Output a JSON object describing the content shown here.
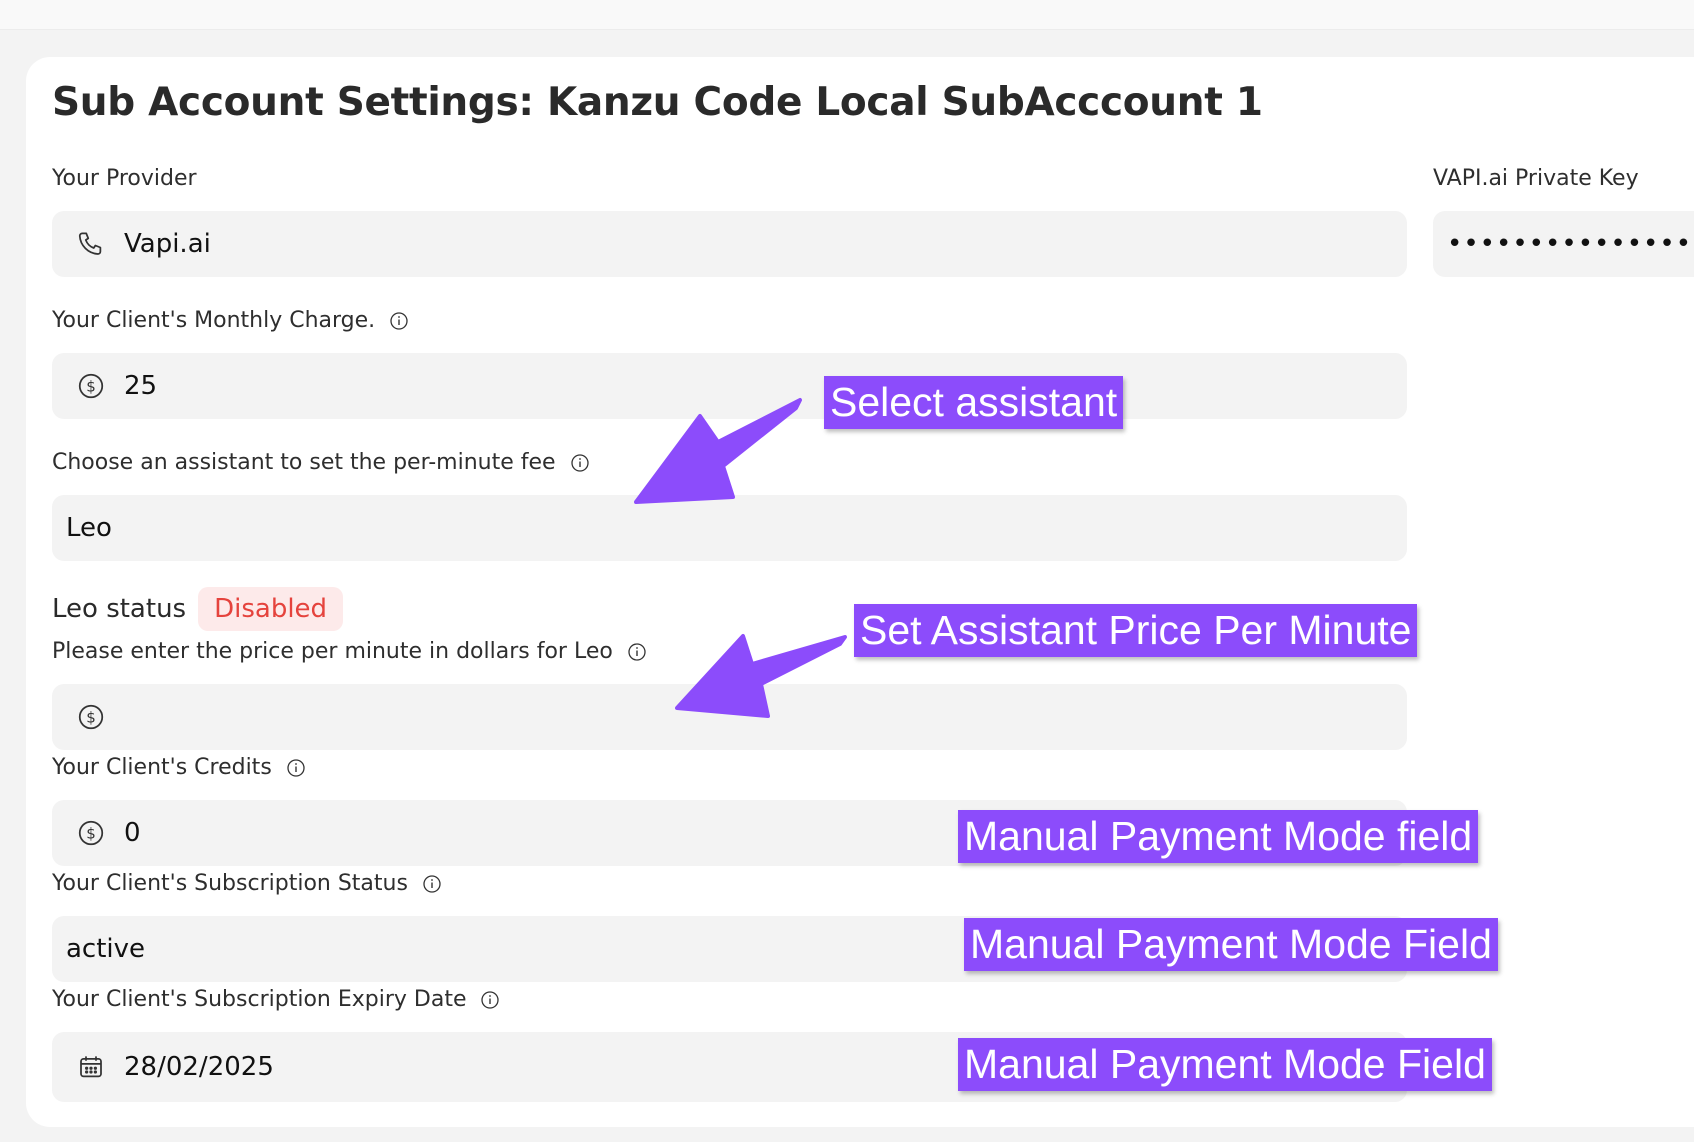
{
  "header": {
    "title": "Sub Account Settings: Kanzu Code Local SubAcccount 1"
  },
  "provider": {
    "label": "Your Provider",
    "value": "Vapi.ai",
    "icon": "phone-icon"
  },
  "vapi_key": {
    "label": "VAPI.ai Private Key",
    "value": "•••••••••••••••••••••••••••"
  },
  "monthly_charge": {
    "label": "Your Client's Monthly Charge.",
    "value": "25",
    "icon": "dollar-icon"
  },
  "assistant": {
    "label": "Choose an assistant to set the per-minute fee",
    "value": "Leo"
  },
  "assistant_status": {
    "label": "Leo status",
    "badge": "Disabled",
    "badge_color": "#e5433d"
  },
  "price_per_minute": {
    "label": "Please enter the price per minute in dollars for Leo",
    "value": "",
    "icon": "dollar-icon"
  },
  "credits": {
    "label": "Your Client's Credits",
    "value": "0",
    "icon": "dollar-icon"
  },
  "subscription_status": {
    "label": "Your Client's Subscription Status",
    "value": "active"
  },
  "expiry_date": {
    "label": "Your Client's Subscription Expiry Date",
    "value": "28/02/2025",
    "icon": "calendar-icon"
  },
  "annotations": {
    "select_assistant": "Select assistant",
    "set_price": "Set Assistant Price Per Minute",
    "manual_payment_1": "Manual Payment Mode field",
    "manual_payment_2": "Manual Payment Mode Field",
    "manual_payment_3": "Manual Payment Mode Field",
    "color": "#8c4cfb"
  }
}
